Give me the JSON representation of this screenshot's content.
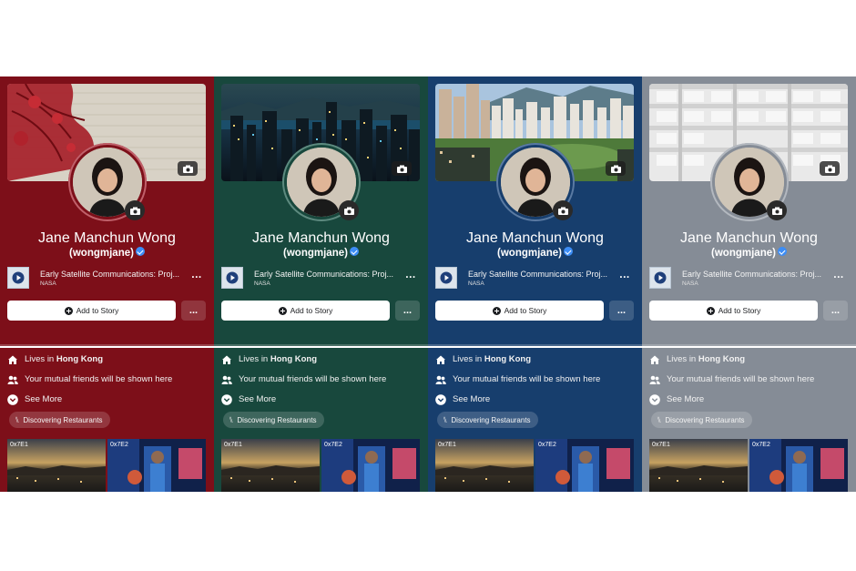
{
  "profile": {
    "name": "Jane Manchun Wong",
    "handle": "(wongmjane)",
    "music_title": "Early Satellite Communications: Proj...",
    "music_artist": "NASA",
    "add_story_label": "Add to Story",
    "more_label": "...",
    "lives_in_prefix": "Lives in ",
    "lives_in_city": "Hong Kong",
    "mutual_friends": "Your mutual friends will be shown here",
    "see_more": "See More",
    "chip_label": "Discovering Restaurants",
    "thumb_1_label": "0x7E1",
    "thumb_2_label": "0x7E2"
  },
  "themes": [
    {
      "name": "red",
      "color": "#7d0f19"
    },
    {
      "name": "green",
      "color": "#18483d"
    },
    {
      "name": "blue",
      "color": "#173e6d"
    },
    {
      "name": "gray",
      "color": "#858c96"
    }
  ],
  "icons": {
    "cover_camera": "camera-icon",
    "avatar_camera": "camera-icon",
    "music_thumb": "play-icon",
    "lives_in": "home-icon",
    "mutual_friends": "friends-icon",
    "see_more": "chevron-down-icon",
    "chip": "fork-knife-icon"
  }
}
